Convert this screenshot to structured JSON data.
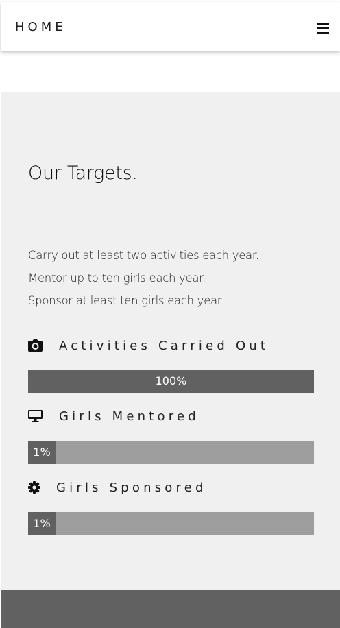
{
  "nav": {
    "home_label": "HOME",
    "menu_icon": "hamburger-menu-icon"
  },
  "targets": {
    "title": "Our Targets.",
    "lines": [
      "Carry out at least two activities each year.",
      "Mentor up to ten girls each year.",
      "Sponsor at least ten girls each year."
    ],
    "stats": [
      {
        "icon": "camera-icon",
        "label": "Activities Carried Out",
        "value_text": "100%",
        "progress": 100
      },
      {
        "icon": "desktop-monitor-icon",
        "label": "Girls Mentored",
        "value_text": "1%",
        "progress": 1
      },
      {
        "icon": "gear-icon",
        "label": "Girls Sponsored",
        "value_text": "1%",
        "progress": 1
      }
    ]
  },
  "colors": {
    "section_bg": "#f0f0f0",
    "bar_track": "#9e9e9e",
    "bar_fill": "#616161",
    "footer_bg": "#616161"
  }
}
